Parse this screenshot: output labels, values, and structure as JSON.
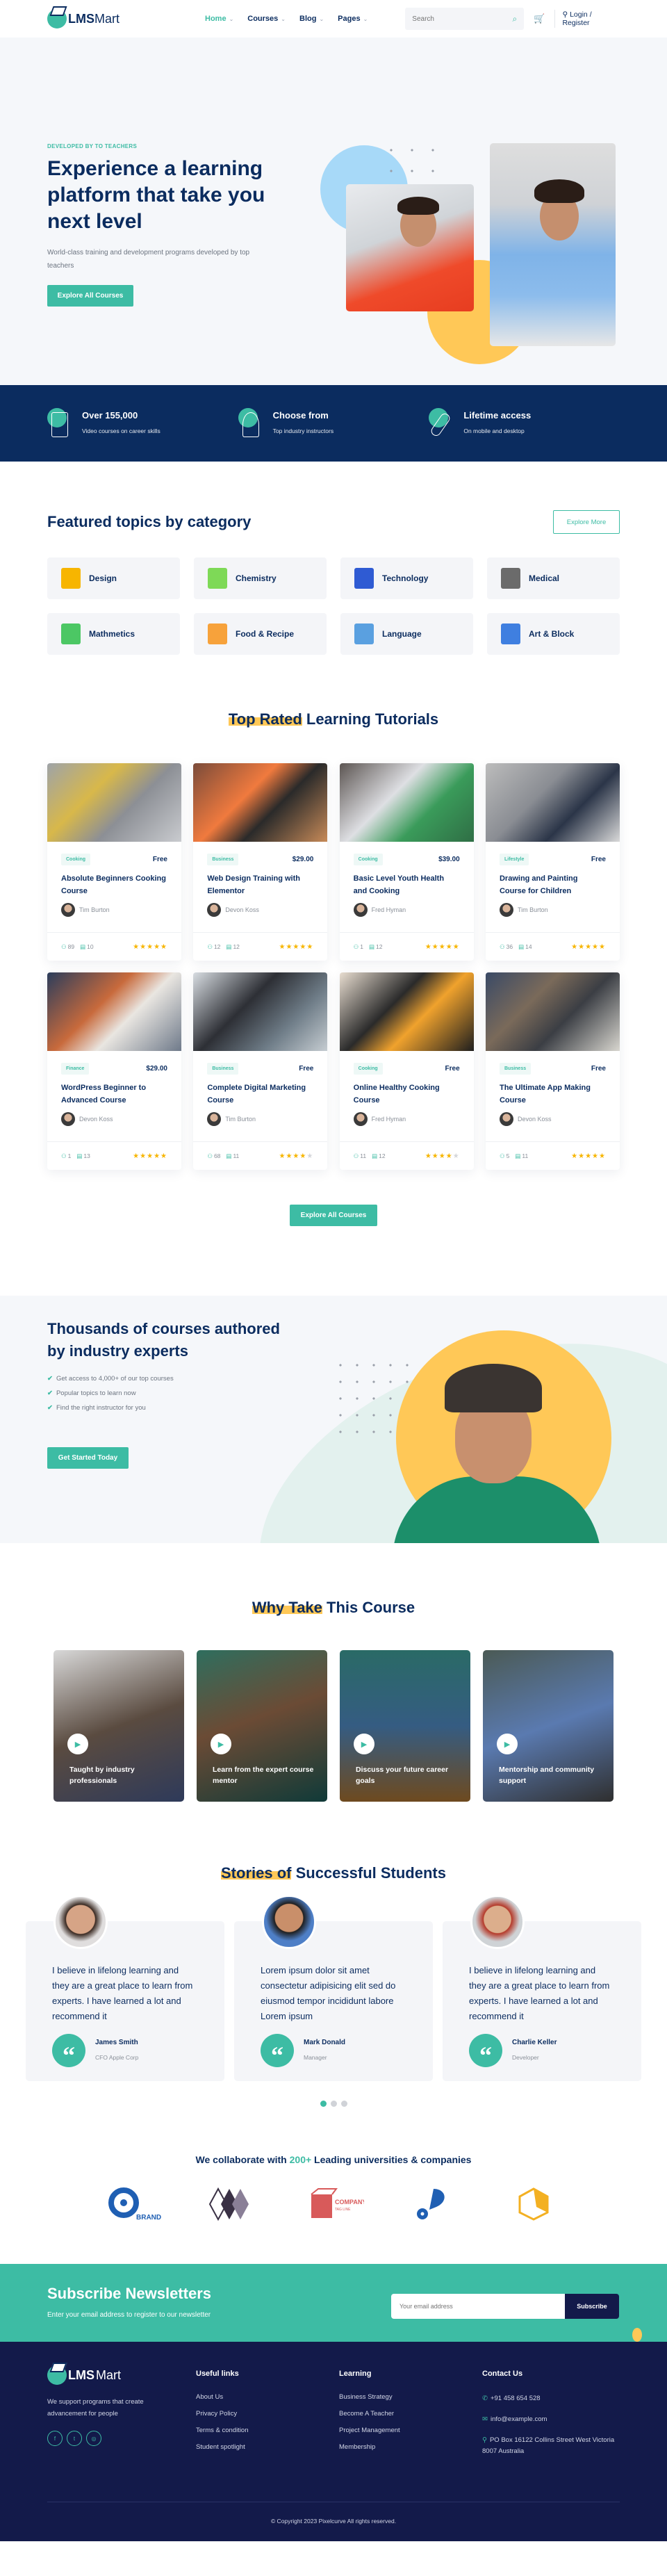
{
  "header": {
    "logo_bold": "LMS",
    "logo_light": "Mart",
    "nav": [
      {
        "label": "Home",
        "active": true
      },
      {
        "label": "Courses",
        "active": false
      },
      {
        "label": "Blog",
        "active": false
      },
      {
        "label": "Pages",
        "active": false
      }
    ],
    "search_placeholder": "Search",
    "login_label": "Login",
    "register_label": "Register"
  },
  "hero": {
    "kicker": "DEVELOPED BY TO TEACHERS",
    "title": "Experience a learning platform that take you next level",
    "subtitle": "World-class training and development programs developed by top teachers",
    "cta": "Explore All Courses"
  },
  "stats": [
    {
      "title": "Over 155,000",
      "subtitle": "Video courses on career skills",
      "icon": "book-icon"
    },
    {
      "title": "Choose from",
      "subtitle": "Top industry instructors",
      "icon": "head-question-icon"
    },
    {
      "title": "Lifetime access",
      "subtitle": "On mobile and desktop",
      "icon": "paperclip-icon"
    }
  ],
  "categories": {
    "title": "Featured topics by category",
    "explore_label": "Explore More",
    "items": [
      {
        "label": "Design",
        "icon": "pencil-ruler-icon",
        "color": "#f7b500"
      },
      {
        "label": "Chemistry",
        "icon": "flask-icon",
        "color": "#7ed957"
      },
      {
        "label": "Technology",
        "icon": "hexagons-icon",
        "color": "#2f5bd3"
      },
      {
        "label": "Medical",
        "icon": "microscope-icon",
        "color": "#6b6b6b"
      },
      {
        "label": "Mathmetics",
        "icon": "calculator-icon",
        "color": "#4cc764"
      },
      {
        "label": "Food & Recipe",
        "icon": "cloche-icon",
        "color": "#f7a23b"
      },
      {
        "label": "Language",
        "icon": "graduate-icon",
        "color": "#5aa0e0"
      },
      {
        "label": "Art & Block",
        "icon": "palette-book-icon",
        "color": "#3f7fe0"
      }
    ]
  },
  "tutorials": {
    "title_highlight": "Top Rated",
    "title_rest": " Learning Tutorials",
    "cta": "Explore All Courses",
    "courses": [
      {
        "tag": "Cooking",
        "price": "Free",
        "title": "Absolute Beginners Cooking Course",
        "author": "Tim Burton",
        "students": "89",
        "lessons": "10",
        "rating": 5,
        "img": "linear-gradient(135deg,#9ea3a8,#d8b84a 35%,#8c8f95 60%,#c9cbcf)"
      },
      {
        "tag": "Business",
        "price": "$29.00",
        "title": "Web Design Training with Elementor",
        "author": "Devon Koss",
        "students": "12",
        "lessons": "12",
        "rating": 5,
        "img": "linear-gradient(135deg,#7a4b3a,#f07a3e 40%,#2a2a2a 60%,#c78a58)"
      },
      {
        "tag": "Cooking",
        "price": "$39.00",
        "title": "Basic Level Youth Health and Cooking",
        "author": "Fred Hyman",
        "students": "1",
        "lessons": "12",
        "rating": 5,
        "img": "linear-gradient(135deg,#5c5552,#dedfe3 40%,#3a9b5a 65%,#2f6e45)"
      },
      {
        "tag": "Lifestyle",
        "price": "Free",
        "title": "Drawing and Painting Course for Children",
        "author": "Tim Burton",
        "students": "36",
        "lessons": "14",
        "rating": 5,
        "img": "linear-gradient(135deg,#bcbcbc,#8a8d93 40%,#2b3548 65%,#d9d9d9)"
      },
      {
        "tag": "Finance",
        "price": "$29.00",
        "title": "WordPress Beginner to Advanced Course",
        "author": "Devon Koss",
        "students": "1",
        "lessons": "13",
        "rating": 5,
        "img": "linear-gradient(135deg,#2b3d5c,#c86a3c 40%,#e9e6e1 60%,#6f7a8a)"
      },
      {
        "tag": "Business",
        "price": "Free",
        "title": "Complete Digital Marketing Course",
        "author": "Tim Burton",
        "students": "68",
        "lessons": "11",
        "rating": 4,
        "img": "linear-gradient(135deg,#d8dde2,#2d2f35 40%,#6f7d88 70%,#c5ccd1)"
      },
      {
        "tag": "Cooking",
        "price": "Free",
        "title": "Online Healthy Cooking Course",
        "author": "Fred Hyman",
        "students": "11",
        "lessons": "12",
        "rating": 4,
        "img": "linear-gradient(135deg,#e8ddd0,#2a2a2a 40%,#f0a22d 60%,#1e1e1e)"
      },
      {
        "tag": "Business",
        "price": "Free",
        "title": "The Ultimate App Making Course",
        "author": "Devon Koss",
        "students": "5",
        "lessons": "11",
        "rating": 5,
        "img": "linear-gradient(135deg,#3a4a66,#7a6a5a 35%,#3b3e44 60%,#d8d6cf)"
      }
    ]
  },
  "experts": {
    "title": "Thousands of courses authored by industry experts",
    "checks": [
      "Get access to 4,000+ of our top courses",
      "Popular topics to learn now",
      "Find the right instructor for you"
    ],
    "cta": "Get Started Today"
  },
  "why": {
    "title_highlight": "Why Take",
    "title_rest": " This Course",
    "cards": [
      {
        "caption": "Taught by industry professionals",
        "img": "linear-gradient(160deg,#d8d8d8,#5a4b40 50%,#2e3a5a)"
      },
      {
        "caption": "Learn from the expert course mentor",
        "img": "linear-gradient(160deg,#2f6e5e,#6b4b35 45%,#103a38)"
      },
      {
        "caption": "Discuss your future career goals",
        "img": "linear-gradient(180deg,#2a6a66,#355c82 50%,#6e4a1f)"
      },
      {
        "caption": "Mentorship and community support",
        "img": "linear-gradient(160deg,#4b5a55,#5a7ab0 50%,#2f2f2f)"
      }
    ]
  },
  "stories": {
    "title_highlight": "Stories of",
    "title_rest": " Successful Students",
    "items": [
      {
        "quote": "I believe in lifelong learning and they are a great place to learn from experts. I have learned a lot and recommend it",
        "name": "James Smith",
        "role": "CFO Apple Corp",
        "avatar": "radial-gradient(circle at 50% 45%,#d6a486 38%,#3a2a22 40%,#e0dede 60%)"
      },
      {
        "quote": "Lorem ipsum dolor sit amet consectetur adipisicing elit sed do eiusmod tempor incididunt labore Lorem ipsum",
        "name": "Mark Donald",
        "role": "Manager",
        "avatar": "radial-gradient(circle at 50% 42%,#c98f6a 36%,#1f1f1f 38%,#4e7fc7 60%)"
      },
      {
        "quote": "I believe in lifelong learning and they are a great place to learn from experts. I have learned a lot and recommend it",
        "name": "Charlie Keller",
        "role": "Developer",
        "avatar": "radial-gradient(circle at 50% 45%,#dcae8c 36%,#b53a2a 38%,#cfd3d6 60%)"
      }
    ],
    "active_slide": 1,
    "slide_count": 3
  },
  "partners": {
    "title_pre": "We collaborate with ",
    "title_num": "200+",
    "title_post": " Leading universities & companies",
    "logos": [
      "brand-logo",
      "diamonds-logo",
      "company-logo",
      "drop-logo",
      "hexagon-logo"
    ],
    "brand_text": "BRAND",
    "company_text": "COMPANY",
    "company_tag": "TAG LINE"
  },
  "newsletter": {
    "title": "Subscribe Newsletters",
    "subtitle": "Enter your email address to register to our newsletter",
    "placeholder": "Your email address",
    "button": "Subscribe"
  },
  "footer": {
    "logo_bold": "LMS",
    "logo_light": "Mart",
    "description": "We support programs that create advancement for people",
    "useful_title": "Useful links",
    "useful": [
      "About Us",
      "Privacy Policy",
      "Terms & condition",
      "Student spotlight"
    ],
    "learning_title": "Learning",
    "learning": [
      "Business Strategy",
      "Become A Teacher",
      "Project Management",
      "Membership"
    ],
    "contact_title": "Contact Us",
    "phone": "+91 458 654 528",
    "email": "info@example.com",
    "address": "PO Box 16122 Collins Street West Victoria 8007 Australia",
    "copyright": "© Copyright 2023 Pixelcurve All rights reserved."
  },
  "colors": {
    "accent": "#3dbca4",
    "navy": "#0b2c5f",
    "footer": "#131a4a",
    "highlight": "#ffc857"
  }
}
